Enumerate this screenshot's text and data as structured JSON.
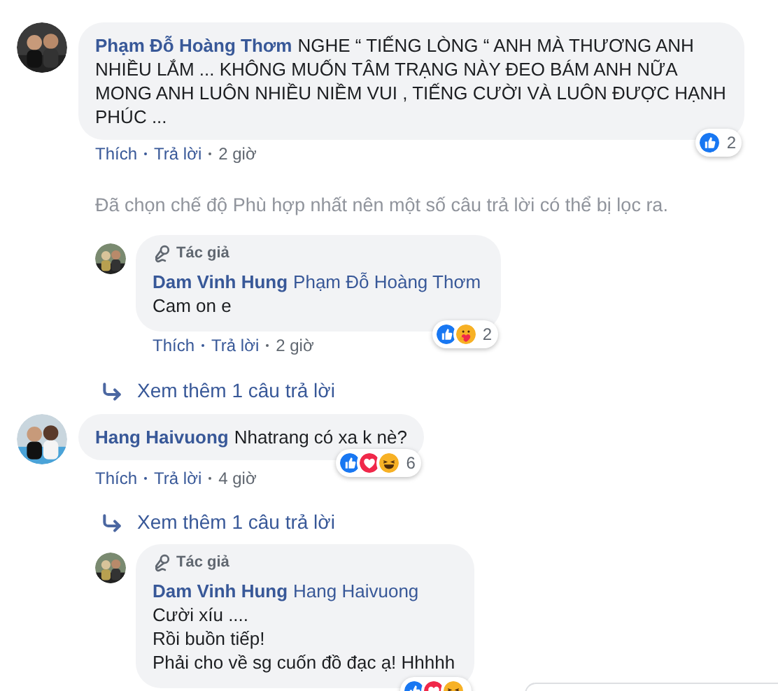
{
  "thread": [
    {
      "kind": "comment",
      "author": "Phạm Đỗ Hoàng Thơm",
      "paragraphs": [
        "NGHE “ TIẾNG LÒNG “ ANH MÀ THƯƠNG ANH NHIỀU LẮM ... KHÔNG MUỐN TÂM TRẠNG NÀY ĐEO BÁM ANH NỮA",
        "MONG ANH LUÔN NHIỀU NIỀM VUI , TIẾNG CƯỜI VÀ LUÔN ĐƯỢC HẠNH PHÚC ..."
      ],
      "actions": [
        "Thích",
        "Trả lời"
      ],
      "time": "2 giờ",
      "reactions": {
        "icons": [
          {
            "kind": "like"
          }
        ],
        "count": "2"
      }
    },
    {
      "kind": "notice",
      "text": "Đã chọn chế độ Phù hợp nhất nên một số câu trả lời có thể bị lọc ra."
    },
    {
      "kind": "reply",
      "badge": "Tác giả",
      "author": "Dam Vinh Hung",
      "mention": "Phạm Đỗ Hoàng Thơm",
      "paragraphs": [
        "Cam on e"
      ],
      "actions": [
        "Thích",
        "Trả lời"
      ],
      "time": "2 giờ",
      "reactions": {
        "icons": [
          {
            "kind": "like"
          },
          {
            "kind": "care"
          }
        ],
        "count": "2"
      }
    },
    {
      "kind": "more",
      "text": "Xem thêm 1 câu trả lời"
    },
    {
      "kind": "comment",
      "author": "Hang Haivuong",
      "paragraphs": [
        "Nhatrang có xa k nè?"
      ],
      "actions": [
        "Thích",
        "Trả lời"
      ],
      "time": "4 giờ",
      "reactions": {
        "icons": [
          {
            "kind": "like"
          },
          {
            "kind": "love"
          },
          {
            "kind": "haha"
          }
        ],
        "count": "6"
      }
    },
    {
      "kind": "more",
      "text": "Xem thêm 1 câu trả lời"
    },
    {
      "kind": "reply",
      "badge": "Tác giả",
      "author": "Dam Vinh Hung",
      "mention": "Hang Haivuong",
      "paragraphs": [
        "Cười xíu ....",
        "Rồi buồn tiếp!",
        "Phải cho về sg cuốn đồ đạc ạ! Hhhhh"
      ],
      "reactions": {
        "icons": [
          {
            "kind": "like"
          },
          {
            "kind": "love"
          },
          {
            "kind": "haha"
          }
        ]
      }
    }
  ]
}
